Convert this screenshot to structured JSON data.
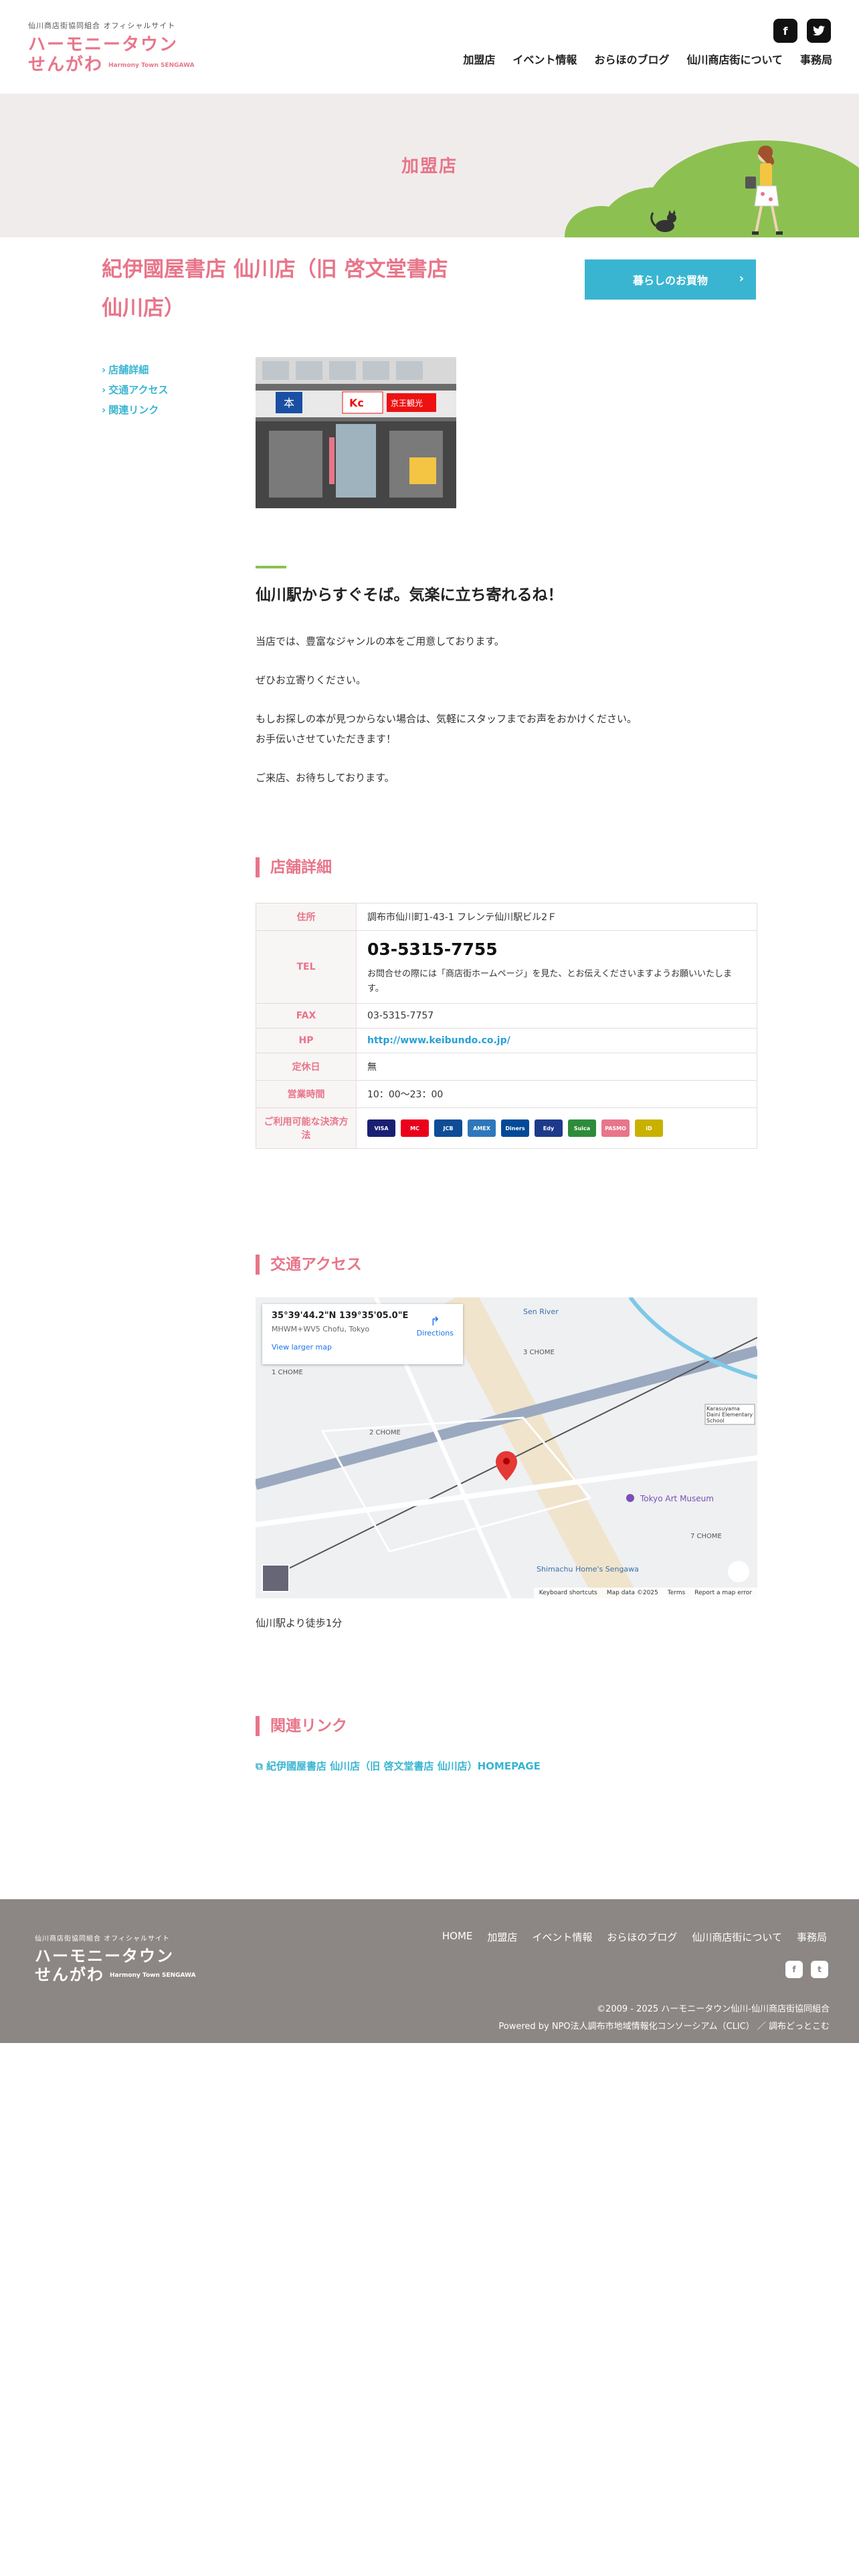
{
  "header": {
    "logo_sub": "仙川商店街協同組合 オフィシャルサイト",
    "logo_main_1": "ハーモニータウン",
    "logo_main_2": "せんがわ",
    "logo_en": "Harmony Town SENGAWA",
    "nav": [
      "加盟店",
      "イベント情報",
      "おらほのブログ",
      "仙川商店街について",
      "事務局"
    ]
  },
  "hero": {
    "title": "加盟店"
  },
  "shop": {
    "title": "紀伊國屋書店 仙川店（旧 啓文堂書店 仙川店）",
    "category_button": "暮らしのお買物"
  },
  "sidenav": [
    "店舗詳細",
    "交通アクセス",
    "関連リンク"
  ],
  "photo_signs": {
    "sign1": "本",
    "sign2": "Kc",
    "sign3": "京王観光"
  },
  "intro": {
    "catch": "仙川駅からすぐそば。気楽に立ち寄れるね！",
    "paragraphs": [
      "当店では、豊富なジャンルの本をご用意しております。",
      "ぜひお立寄りください。",
      "もしお探しの本が見つからない場合は、気軽にスタッフまでお声をおかけください。",
      "お手伝いさせていただきます！",
      "ご来店、お待ちしております。"
    ]
  },
  "details": {
    "heading": "店舗詳細",
    "rows": {
      "address_label": "住所",
      "address": "調布市仙川町1-43-1 フレンテ仙川駅ビル2Ｆ",
      "tel_label": "TEL",
      "tel": "03-5315-7755",
      "tel_note": "お問合せの際には「商店街ホームページ」を見た、とお伝えくださいますようお願いいたします。",
      "fax_label": "FAX",
      "fax": "03-5315-7757",
      "hp_label": "HP",
      "hp": "http://www.keibundo.co.jp/",
      "holiday_label": "定休日",
      "holiday": "無",
      "hours_label": "営業時間",
      "hours": "10：00〜23：00",
      "payment_label": "ご利用可能な決済方法"
    },
    "payments": [
      "VISA",
      "MC",
      "JCB",
      "AMEX",
      "Diners",
      "Edy",
      "Suica",
      "PASMO",
      "iD"
    ]
  },
  "access": {
    "heading": "交通アクセス",
    "map_coord": "35°39'44.2\"N 139°35'05.0\"E",
    "map_addr": "MHWM+WV5 Chofu, Tokyo",
    "map_larger": "View larger map",
    "map_directions": "Directions",
    "map_labels": {
      "l1": "Sen River",
      "l2": "Tokyo Art Museum",
      "l3": "1 CHOME",
      "l4": "2 CHOME",
      "l5": "3 CHOME",
      "l6": "7 CHOME",
      "l7": "Karasuyama Daini Elementary School",
      "l8": "Shimachu Home's Sengawa"
    },
    "map_footer": [
      "Keyboard shortcuts",
      "Map data ©2025",
      "Terms",
      "Report a map error"
    ],
    "text": "仙川駅より徒歩1分"
  },
  "related": {
    "heading": "関連リンク",
    "link": "紀伊國屋書店 仙川店（旧 啓文堂書店 仙川店）HOMEPAGE"
  },
  "footer": {
    "logo_sub": "仙川商店街協同組合 オフィシャルサイト",
    "logo_main_1": "ハーモニータウン",
    "logo_main_2": "せんがわ",
    "logo_en": "Harmony Town SENGAWA",
    "nav": [
      "HOME",
      "加盟店",
      "イベント情報",
      "おらほのブログ",
      "仙川商店街について",
      "事務局"
    ],
    "copyright": "©2009 - 2025 ハーモニータウン仙川-仙川商店街協同組合",
    "powered": "Powered by NPO法人調布市地域情報化コンソーシアム（CLIC） ／ 調布どっとこむ"
  },
  "colors": {
    "accent_pink": "#e8758a",
    "accent_blue": "#3ab5d1",
    "accent_green": "#8cc152",
    "footer_bg": "#8c8685"
  }
}
